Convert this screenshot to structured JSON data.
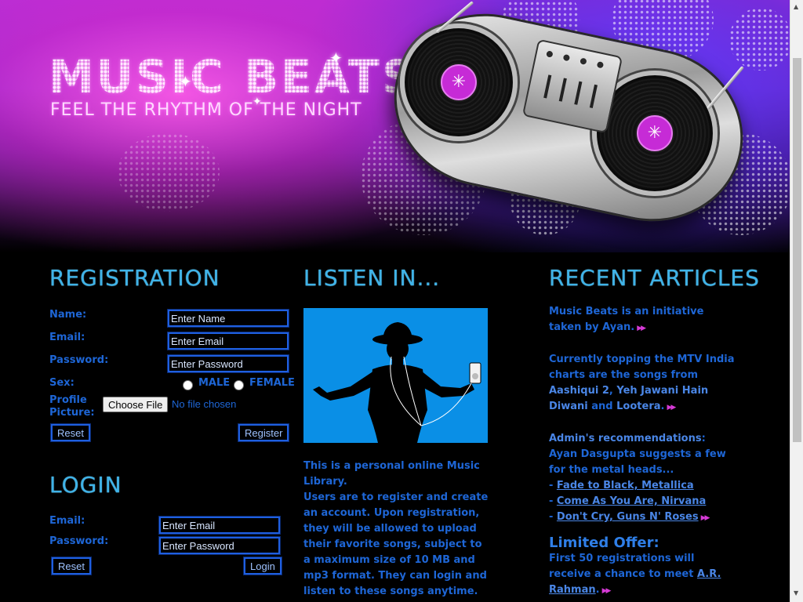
{
  "banner": {
    "title": "MUSIC BEATS",
    "tagline": "FEEL THE RHYTHM OF THE NIGHT"
  },
  "registration": {
    "heading": "REGISTRATION",
    "name_label": "Name:",
    "name_placeholder": "Enter Name",
    "email_label": "Email:",
    "email_placeholder": "Enter Email",
    "password_label": "Password:",
    "password_placeholder": "Enter Password",
    "sex_label": "Sex:",
    "male_label": "MALE",
    "female_label": "FEMALE",
    "profile_label_1": "Profile",
    "profile_label_2": "Picture:",
    "choose_file_label": "Choose File",
    "no_file_label": "No file chosen",
    "reset_label": "Reset",
    "register_label": "Register"
  },
  "login": {
    "heading": "LOGIN",
    "email_label": "Email:",
    "email_placeholder": "Enter Email",
    "password_label": "Password:",
    "password_placeholder": "Enter Password",
    "reset_label": "Reset",
    "login_label": "Login"
  },
  "listen": {
    "heading": "LISTEN IN...",
    "text_1": "This is a personal online Music Library.",
    "text_2": "Users are to register and create an account. Upon registration, they will be allowed to upload their favorite songs, subject to a maximum size of 10 MB and mp3 format. They can login and listen to these songs anytime."
  },
  "articles": {
    "heading": "RECENT ARTICLES",
    "p1": "Music Beats is an initiative taken by Ayan.",
    "p2_pre": "Currently topping the MTV India charts are the songs from ",
    "p2_song1": "Aashiqui 2",
    "p2_sep1": ", ",
    "p2_song2": "Yeh Jawani Hain Diwani",
    "p2_and": " and ",
    "p2_song3": "Lootera",
    "p2_end": ".",
    "p3_title": "Admin's recommendations",
    "p3_text": ": Ayan Dasgupta suggests a few for the metal heads...",
    "rec_dash": "- ",
    "rec_1": "Fade to Black, Metallica ",
    "rec_2": "Come As You Are, Nirvana ",
    "rec_3": "Don't Cry, Guns N' Roses",
    "offer_title": "Limited Offer:",
    "offer_text": "First 50 registrations will receive a chance to meet ",
    "offer_link": "A.R. Rahman",
    "offer_end": ".",
    "arrow_glyph": "▶▶"
  },
  "colors": {
    "heading": "#3fb3e8",
    "text": "#1e66d6",
    "accent": "#d63ad6",
    "input_border": "#1f5fe0",
    "listen_bg": "#0a8fe6"
  }
}
